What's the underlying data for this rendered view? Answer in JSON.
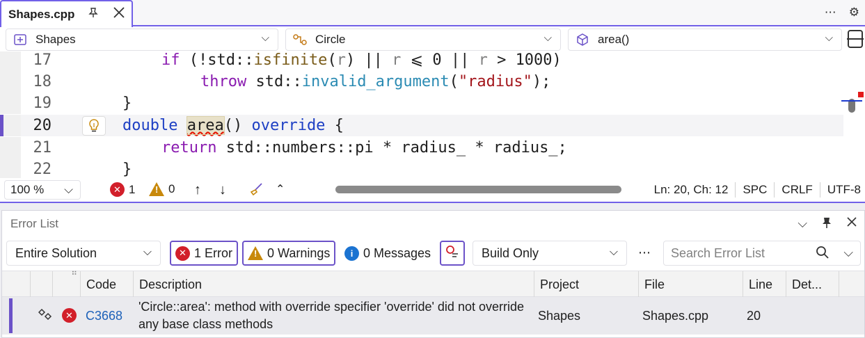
{
  "tab": {
    "title": "Shapes.cpp"
  },
  "nav": {
    "project": "Shapes",
    "scope": "Circle",
    "member": "area()"
  },
  "code": {
    "lines": [
      {
        "num": "17"
      },
      {
        "num": "18"
      },
      {
        "num": "19"
      },
      {
        "num": "20"
      },
      {
        "num": "21"
      },
      {
        "num": "22"
      }
    ],
    "l17": {
      "t1": "if",
      "t2": " (!std::",
      "t3": "isfinite",
      "t4": "(",
      "t5": "r",
      "t6": ") || ",
      "t7": "r",
      "t8": " ⩽ 0 || ",
      "t9": "r",
      "t10": " > 1000)"
    },
    "l18": {
      "t1": "throw",
      "t2": " std::",
      "t3": "invalid_argument",
      "t4": "(",
      "t5": "\"radius\"",
      "t6": ");"
    },
    "l19": {
      "t1": "}"
    },
    "l20": {
      "t1": "double",
      "t2": " ",
      "t3": "area",
      "t4": "() ",
      "t5": "override",
      "t6": " {"
    },
    "l21": {
      "t1": "return",
      "t2": " std::numbers::pi * radius_ * radius_;"
    },
    "l22": {
      "t1": "}"
    }
  },
  "status": {
    "zoom": "100 %",
    "errors": "1",
    "warnings": "0",
    "position": "Ln: 20, Ch: 12",
    "indent": "SPC",
    "eol": "CRLF",
    "encoding": "UTF-8"
  },
  "error_list": {
    "title": "Error List",
    "scope": "Entire Solution",
    "errors_btn": "1 Error",
    "warnings_btn": "0 Warnings",
    "messages_btn": "0 Messages",
    "build_filter": "Build Only",
    "search_placeholder": "Search Error List",
    "columns": {
      "code": "Code",
      "description": "Description",
      "project": "Project",
      "file": "File",
      "line": "Line",
      "details": "Det..."
    },
    "rows": [
      {
        "code": "C3668",
        "description_1": "'Circle::area': method with override specifier 'override' did not override",
        "description_2": "any base class methods",
        "project": "Shapes",
        "file": "Shapes.cpp",
        "line": "20"
      }
    ]
  },
  "colors": {
    "accent": "#7160e8",
    "error": "#d21f2a",
    "warning": "#c8890b",
    "info": "#1b73d1"
  }
}
